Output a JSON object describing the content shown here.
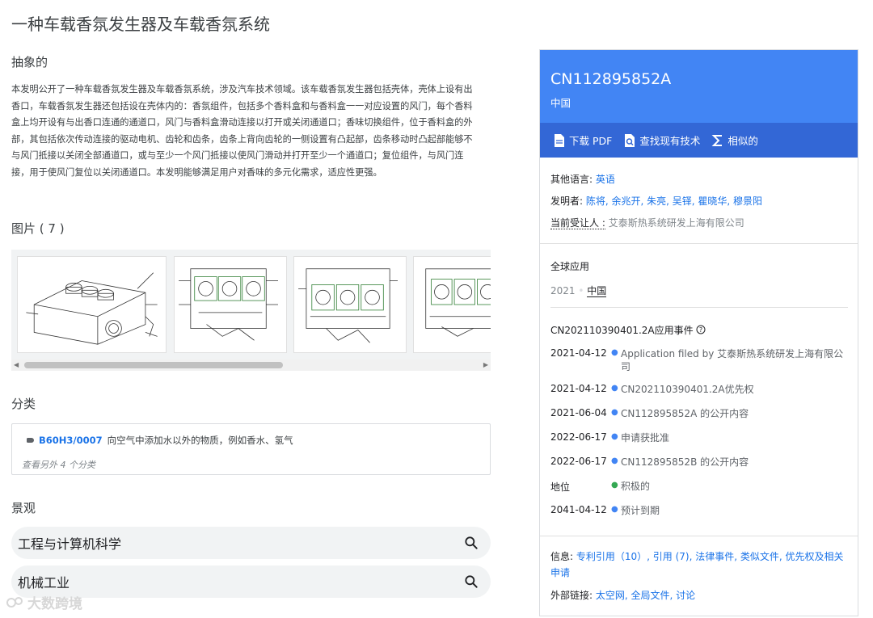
{
  "title": "一种车载香氛发生器及车载香氛系统",
  "abstract": {
    "heading": "抽象的",
    "text": "本发明公开了一种车载香氛发生器及车载香氛系统，涉及汽车技术领域。该车载香氛发生器包括壳体，壳体上设有出香口，车载香氛发生器还包括设在壳体内的：香氛组件，包括多个香料盒和与香料盒一一对应设置的风门，每个香料盒上均开设有与出香口连通的通道口，风门与香料盒滑动连接以打开或关闭通道口；香味切换组件，位于香料盒的外部，其包括依次传动连接的驱动电机、齿轮和齿条，齿条上背向齿轮的一侧设置有凸起部，齿条移动时凸起部能够不与风门抵接以关闭全部通道口，或与至少一个风门抵接以使风门滑动并打开至少一个通道口；复位组件，与风门连接，用于使风门复位以关闭通道口。本发明能够满足用户对香味的多元化需求，适应性更强。"
  },
  "images": {
    "heading": "图片 ( 7 )",
    "count": 7
  },
  "classification": {
    "heading": "分类",
    "code": "B60H3/0007",
    "description": "向空气中添加水以外的物质，例如香水、氢气",
    "more": "查看另外 4 个分类"
  },
  "landscape": {
    "heading": "景观",
    "items": [
      "工程与计算机科学",
      "机械工业"
    ]
  },
  "watermark": "大数跨境",
  "panel": {
    "pub_number": "CN112895852A",
    "country": "中国",
    "actions": {
      "download": "下载 PDF",
      "prior_art": "查找现有技术",
      "similar": "相似的"
    },
    "other_lang_label": "其他语言:",
    "other_lang_value": "英语",
    "inventors_label": "发明者:",
    "inventors_value": "陈将, 余兆开, 朱亮, 吴铎, 瞿晓华, 穆景阳",
    "assignee_label": "当前受让人 :",
    "assignee_value": "艾泰斯热系统研发上海有限公司",
    "global_label": "全球应用",
    "global_year": "2021",
    "global_country": "中国",
    "events_heading": "CN202110390401.2A应用事件",
    "events": [
      {
        "date": "2021-04-12",
        "text": "Application filed by 艾泰斯热系统研发上海有限公司"
      },
      {
        "date": "2021-04-12",
        "text": "CN202110390401.2A优先权"
      },
      {
        "date": "2021-06-04",
        "text": "CN112895852A 的公开内容"
      },
      {
        "date": "2022-06-17",
        "text": "申请获批准"
      },
      {
        "date": "2022-06-17",
        "text": "CN112895852B 的公开内容"
      },
      {
        "date": "地位",
        "text": "积极的"
      },
      {
        "date": "2041-04-12",
        "text": "预计到期"
      }
    ],
    "info_label": "信息:",
    "info_links": "专利引用（10）, 引用 (7), 法律事件, 类似文件, 优先权及相关申请",
    "external_label": "外部链接:",
    "external_links": "太空网, 全局文件, 讨论"
  },
  "colors": {
    "header_blue": "#4285f4",
    "action_bar_blue": "#3367d6",
    "link_blue": "#1a73e8",
    "status_green": "#34a853"
  }
}
